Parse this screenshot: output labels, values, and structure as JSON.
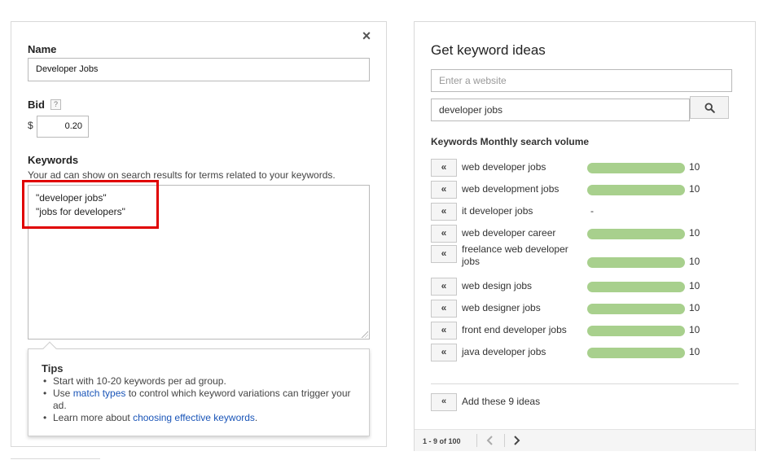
{
  "left": {
    "close_glyph": "×",
    "name_label": "Name",
    "name_value": "Developer Jobs",
    "bid_label": "Bid",
    "help_glyph": "?",
    "currency": "$",
    "bid_value": "0.20",
    "keywords_label": "Keywords",
    "keywords_desc": "Your ad can show on search results for terms related to your keywords.",
    "keywords_lines": [
      "\"developer jobs\"",
      "\"jobs for developers\""
    ],
    "tips": {
      "title": "Tips",
      "item1": "Start with 10-20 keywords per ad group.",
      "item2_pre": "Use ",
      "item2_link": "match types",
      "item2_post": " to control which keyword variations can trigger your ad.",
      "item3_pre": "Learn more about ",
      "item3_link": "choosing effective keywords",
      "item3_post": "."
    }
  },
  "right": {
    "title": "Get keyword ideas",
    "website_placeholder": "Enter a website",
    "search_value": "developer jobs",
    "column_header": "Keywords Monthly search volume",
    "add_glyph": "«",
    "ideas": [
      {
        "keyword": "web developer jobs",
        "volume": "10",
        "has_bar": true
      },
      {
        "keyword": "web development jobs",
        "volume": "10",
        "has_bar": true
      },
      {
        "keyword": "it developer jobs",
        "volume": "-",
        "has_bar": false
      },
      {
        "keyword": "web developer career",
        "volume": "10",
        "has_bar": true
      },
      {
        "keyword": "freelance web developer jobs",
        "volume": "10",
        "has_bar": true
      },
      {
        "keyword": "web design jobs",
        "volume": "10",
        "has_bar": true
      },
      {
        "keyword": "web designer jobs",
        "volume": "10",
        "has_bar": true
      },
      {
        "keyword": "front end developer jobs",
        "volume": "10",
        "has_bar": true
      },
      {
        "keyword": "java developer jobs",
        "volume": "10",
        "has_bar": true
      }
    ],
    "add_all_label": "Add these 9 ideas",
    "pager_text": "1 - 9 of 100",
    "bar_color": "#a8d08d"
  }
}
